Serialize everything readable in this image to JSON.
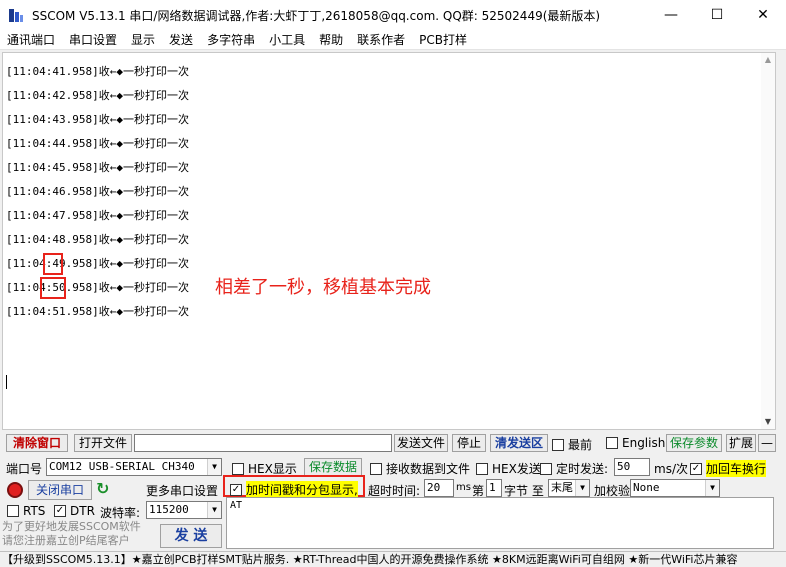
{
  "window": {
    "title": "SSCOM V5.13.1 串口/网络数据调试器,作者:大虾丁丁,2618058@qq.com. QQ群: 52502449(最新版本)",
    "minimize": "—",
    "maximize": "☐",
    "close": "✕"
  },
  "menu": [
    "通讯端口",
    "串口设置",
    "显示",
    "发送",
    "多字符串",
    "小工具",
    "帮助",
    "联系作者",
    "PCB打样"
  ],
  "log": [
    "[11:04:41.958]收←◆一秒打印一次",
    "[11:04:42.958]收←◆一秒打印一次",
    "[11:04:43.958]收←◆一秒打印一次",
    "[11:04:44.958]收←◆一秒打印一次",
    "[11:04:45.958]收←◆一秒打印一次",
    "[11:04:46.958]收←◆一秒打印一次",
    "[11:04:47.958]收←◆一秒打印一次",
    "[11:04:48.958]收←◆一秒打印一次",
    "[11:04:49.958]收←◆一秒打印一次",
    "[11:04:50.958]收←◆一秒打印一次",
    "[11:04:51.958]收←◆一秒打印一次"
  ],
  "annotation": "相差了一秒，移植基本完成",
  "row1": {
    "clear_window": "清除窗口",
    "open_file": "打开文件",
    "send_file": "发送文件",
    "stop": "停止",
    "clear_send": "清发送区",
    "topmost": "最前",
    "english": "English",
    "save_params": "保存参数",
    "expand": "扩展",
    "collapse": "—"
  },
  "row2": {
    "port_label": "端口号",
    "port_value": "COM12 USB-SERIAL CH340",
    "hex_display": "HEX显示",
    "save_data": "保存数据",
    "recv_to_file": "接收数据到文件",
    "hex_send": "HEX发送",
    "timed_send": "定时发送:",
    "interval_value": "50",
    "interval_unit": "ms/次",
    "add_crlf": "加回车换行"
  },
  "row3": {
    "close_port": "关闭串口",
    "more_settings": "更多串口设置",
    "timestamp": "加时间戳和分包显示,",
    "timeout_label": "超时时间:",
    "timeout_value": "20",
    "timeout_unit": "ms",
    "frame_label": "第",
    "frame_value": "1",
    "byte_label": "字节 至",
    "end_value": "末尾",
    "checksum_label": "加校验",
    "checksum_value": "None"
  },
  "row4": {
    "rts": "RTS",
    "dtr": "DTR",
    "baud_label": "波特率:",
    "baud_value": "115200",
    "send": "发 送"
  },
  "send_text": "AT",
  "promo": [
    "为了更好地发展SSCOM软件",
    "请您注册嘉立创P结尾客户"
  ],
  "statusbar": "【升级到SSCOM5.13.1】★嘉立创PCB打样SMT贴片服务. ★RT-Thread中国人的开源免费操作系统 ★8KM远距离WiFi可自组网 ★新一代WiFi芯片兼容"
}
